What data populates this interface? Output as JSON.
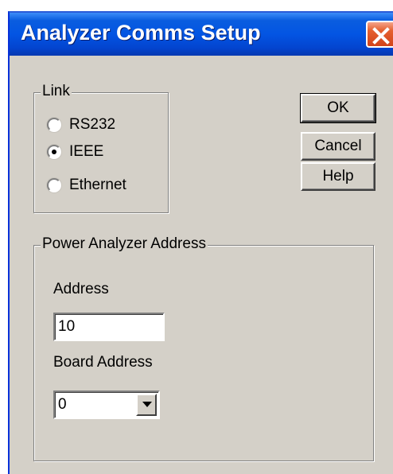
{
  "window": {
    "title": "Analyzer Comms Setup"
  },
  "link_group": {
    "legend": "Link",
    "options": [
      {
        "label": "RS232",
        "selected": false
      },
      {
        "label": "IEEE",
        "selected": true
      },
      {
        "label": "Ethernet",
        "selected": false
      }
    ]
  },
  "buttons": {
    "ok": "OK",
    "cancel": "Cancel",
    "help": "Help"
  },
  "address_group": {
    "legend": "Power Analyzer Address",
    "address_label": "Address",
    "address_value": "10",
    "board_address_label": "Board Address",
    "board_address_value": "0"
  },
  "icons": {
    "close": "close-icon",
    "dropdown": "chevron-down-icon"
  },
  "colors": {
    "titlebar": "#0355e3",
    "dialog_bg": "#d4d0c8",
    "close_button": "#d2431a"
  }
}
